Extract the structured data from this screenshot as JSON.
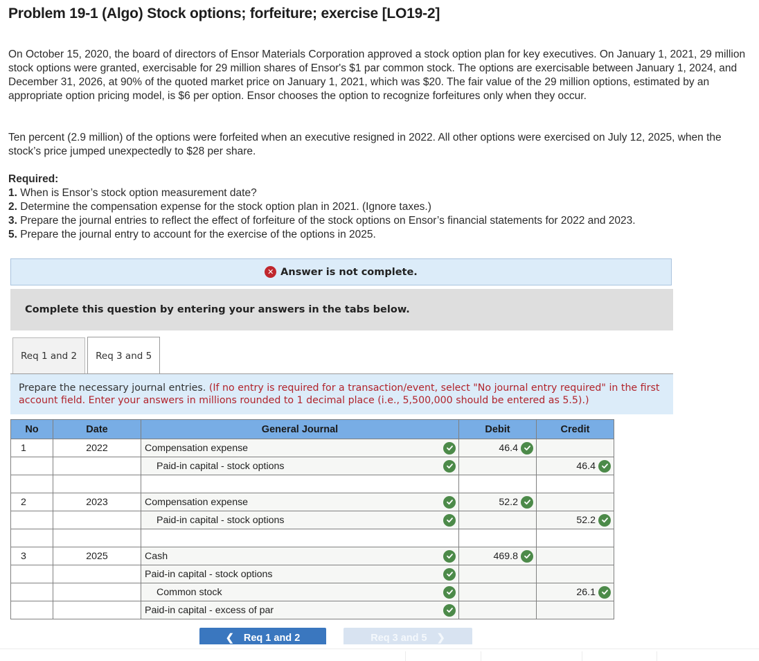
{
  "problem": {
    "title": "Problem 19-1 (Algo) Stock options; forfeiture; exercise [LO19-2]",
    "paragraphs": [
      "On October 15, 2020, the board of directors of Ensor Materials Corporation approved a stock option plan for key executives. On January 1, 2021, 29 million stock options were granted, exercisable for 29 million shares of Ensor's $1 par common stock. The options are exercisable between January 1, 2024, and December 31, 2026, at 90% of the quoted market price on January 1, 2021, which was $20. The fair value of the 29 million options, estimated by an appropriate option pricing model, is $6 per option. Ensor chooses the option to recognize forfeitures only when they occur.",
      "Ten percent (2.9 million) of the options were forfeited when an executive resigned in 2022. All other options were exercised on July 12, 2025, when the stock’s price jumped unexpectedly to $28 per share."
    ],
    "required_label": "Required:",
    "requirements": [
      {
        "num": "1.",
        "text": "When is Ensor’s stock option measurement date?"
      },
      {
        "num": "2.",
        "text": "Determine the compensation expense for the stock option plan in 2021. (Ignore taxes.)"
      },
      {
        "num": "3.",
        "text": "Prepare the journal entries to reflect the effect of forfeiture of the stock options on Ensor’s financial statements for 2022 and 2023."
      },
      {
        "num": "5.",
        "text": "Prepare the journal entry to account for the exercise of the options in 2025."
      }
    ]
  },
  "status": {
    "icon": "x-circle-icon",
    "message": "Answer is not complete.",
    "color": "#c0272d"
  },
  "instruction": "Complete this question by entering your answers in the tabs below.",
  "tabs": [
    {
      "label": "Req 1 and 2",
      "active": false
    },
    {
      "label": "Req 3 and 5",
      "active": true
    }
  ],
  "prepare": {
    "lead": "Prepare the necessary journal entries.",
    "note": "(If no entry is required for a transaction/event, select \"No journal entry required\" in the first account field. Enter your answers in millions rounded to 1 decimal place (i.e., 5,500,000 should be entered as 5.5).)"
  },
  "journal": {
    "headers": {
      "no": "No",
      "date": "Date",
      "account": "General Journal",
      "debit": "Debit",
      "credit": "Credit"
    },
    "header_color": "#78ade5",
    "rows": [
      {
        "no": "1",
        "date": "2022",
        "account": "Compensation expense",
        "indent": false,
        "acct_check": true,
        "debit": "46.4",
        "credit": ""
      },
      {
        "no": "",
        "date": "",
        "account": "Paid-in capital - stock options",
        "indent": true,
        "acct_check": true,
        "debit": "",
        "credit": "46.4"
      },
      {
        "no": "",
        "date": "",
        "account": "",
        "indent": false,
        "acct_check": false,
        "debit": "",
        "credit": ""
      },
      {
        "no": "2",
        "date": "2023",
        "account": "Compensation expense",
        "indent": false,
        "acct_check": true,
        "debit": "52.2",
        "credit": ""
      },
      {
        "no": "",
        "date": "",
        "account": "Paid-in capital - stock options",
        "indent": true,
        "acct_check": true,
        "debit": "",
        "credit": "52.2"
      },
      {
        "no": "",
        "date": "",
        "account": "",
        "indent": false,
        "acct_check": false,
        "debit": "",
        "credit": ""
      },
      {
        "no": "3",
        "date": "2025",
        "account": "Cash",
        "indent": false,
        "acct_check": true,
        "debit": "469.8",
        "credit": ""
      },
      {
        "no": "",
        "date": "",
        "account": "Paid-in capital - stock options",
        "indent": false,
        "acct_check": true,
        "debit": "",
        "credit": ""
      },
      {
        "no": "",
        "date": "",
        "account": "Common stock",
        "indent": true,
        "acct_check": true,
        "debit": "",
        "credit": "26.1"
      },
      {
        "no": "",
        "date": "",
        "account": "Paid-in capital - excess of par",
        "indent": false,
        "acct_check": true,
        "debit": "",
        "credit": ""
      }
    ],
    "check_color": "#4c8a49"
  },
  "nav": {
    "prev_label": "Req 1 and 2",
    "next_label": "Req 3 and 5",
    "prev_color": "#3a77bf",
    "next_color": "#d8e3f1"
  }
}
